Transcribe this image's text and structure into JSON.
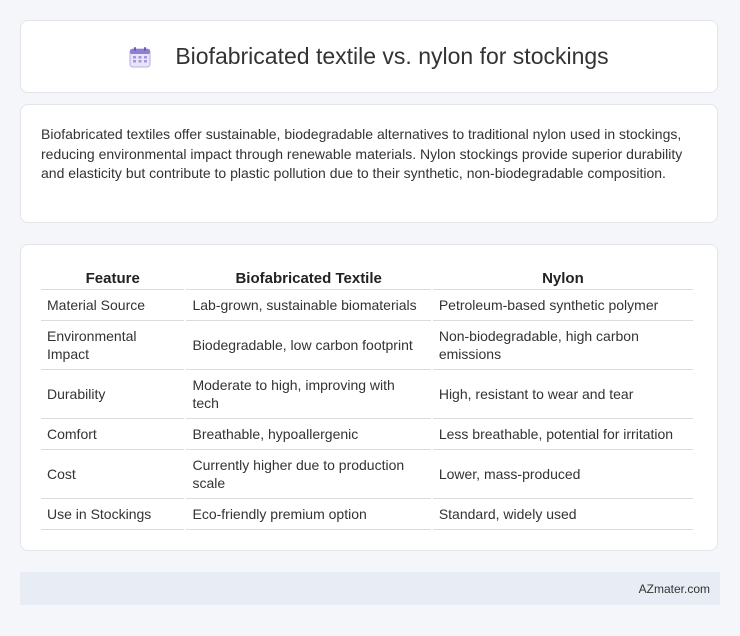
{
  "header": {
    "title": "Biofabricated textile vs. nylon for stockings",
    "icon": "calendar-icon"
  },
  "summary": {
    "text": "Biofabricated textiles offer sustainable, biodegradable alternatives to traditional nylon used in stockings, reducing environmental impact through renewable materials. Nylon stockings provide superior durability and elasticity but contribute to plastic pollution due to their synthetic, non-biodegradable composition."
  },
  "table": {
    "headers": [
      "Feature",
      "Biofabricated Textile",
      "Nylon"
    ],
    "rows": [
      [
        "Material Source",
        "Lab-grown, sustainable biomaterials",
        "Petroleum-based synthetic polymer"
      ],
      [
        "Environmental Impact",
        "Biodegradable, low carbon footprint",
        "Non-biodegradable, high carbon emissions"
      ],
      [
        "Durability",
        "Moderate to high, improving with tech",
        "High, resistant to wear and tear"
      ],
      [
        "Comfort",
        "Breathable, hypoallergenic",
        "Less breathable, potential for irritation"
      ],
      [
        "Cost",
        "Currently higher due to production scale",
        "Lower, mass-produced"
      ],
      [
        "Use in Stockings",
        "Eco-friendly premium option",
        "Standard, widely used"
      ]
    ]
  },
  "footer": {
    "brand": "AZmater.com"
  },
  "colors": {
    "background": "#f5f6fa",
    "card": "#ffffff",
    "footer_bg": "#e7ecf5"
  }
}
